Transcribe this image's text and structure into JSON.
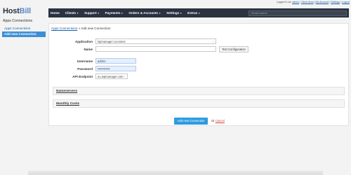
{
  "top_links": {
    "prefix": "Logged in as:",
    "user": "admin",
    "client_area": "Client Area",
    "my_account": "My Account",
    "settings": "Settings",
    "logout": "Logout"
  },
  "logo": {
    "part1": "Host",
    "part2": "Bill"
  },
  "sidebar": {
    "title": "Apps Connections",
    "items": [
      {
        "label": "Apps Connections"
      },
      {
        "label": "Add new Connection"
      }
    ]
  },
  "nav": {
    "items": [
      {
        "label": "Home"
      },
      {
        "label": "Clients"
      },
      {
        "label": "Support"
      },
      {
        "label": "Payments"
      },
      {
        "label": "Orders & Accounts"
      },
      {
        "label": "Settings"
      },
      {
        "label": "Extras"
      }
    ],
    "search_placeholder": "Smart search"
  },
  "breadcrumb": {
    "link": "Apps Connections",
    "current": "Add new Connection"
  },
  "form": {
    "application_label": "Application",
    "application_value": "ispmanager Licenses",
    "name_label": "Name",
    "name_value": "",
    "test_button": "Test Configuration",
    "username_label": "Username",
    "username_value": "admin",
    "password_label": "Password",
    "password_value": "••••••••••••",
    "endpoint_label": "API Endpoint",
    "endpoint_value": "eu.ispmanager.com"
  },
  "sections": [
    {
      "label": "Nameservers"
    },
    {
      "label": "Monthly Costs"
    }
  ],
  "actions": {
    "add_button": "Add new Connection",
    "or": "Or",
    "cancel": "Cancel"
  }
}
